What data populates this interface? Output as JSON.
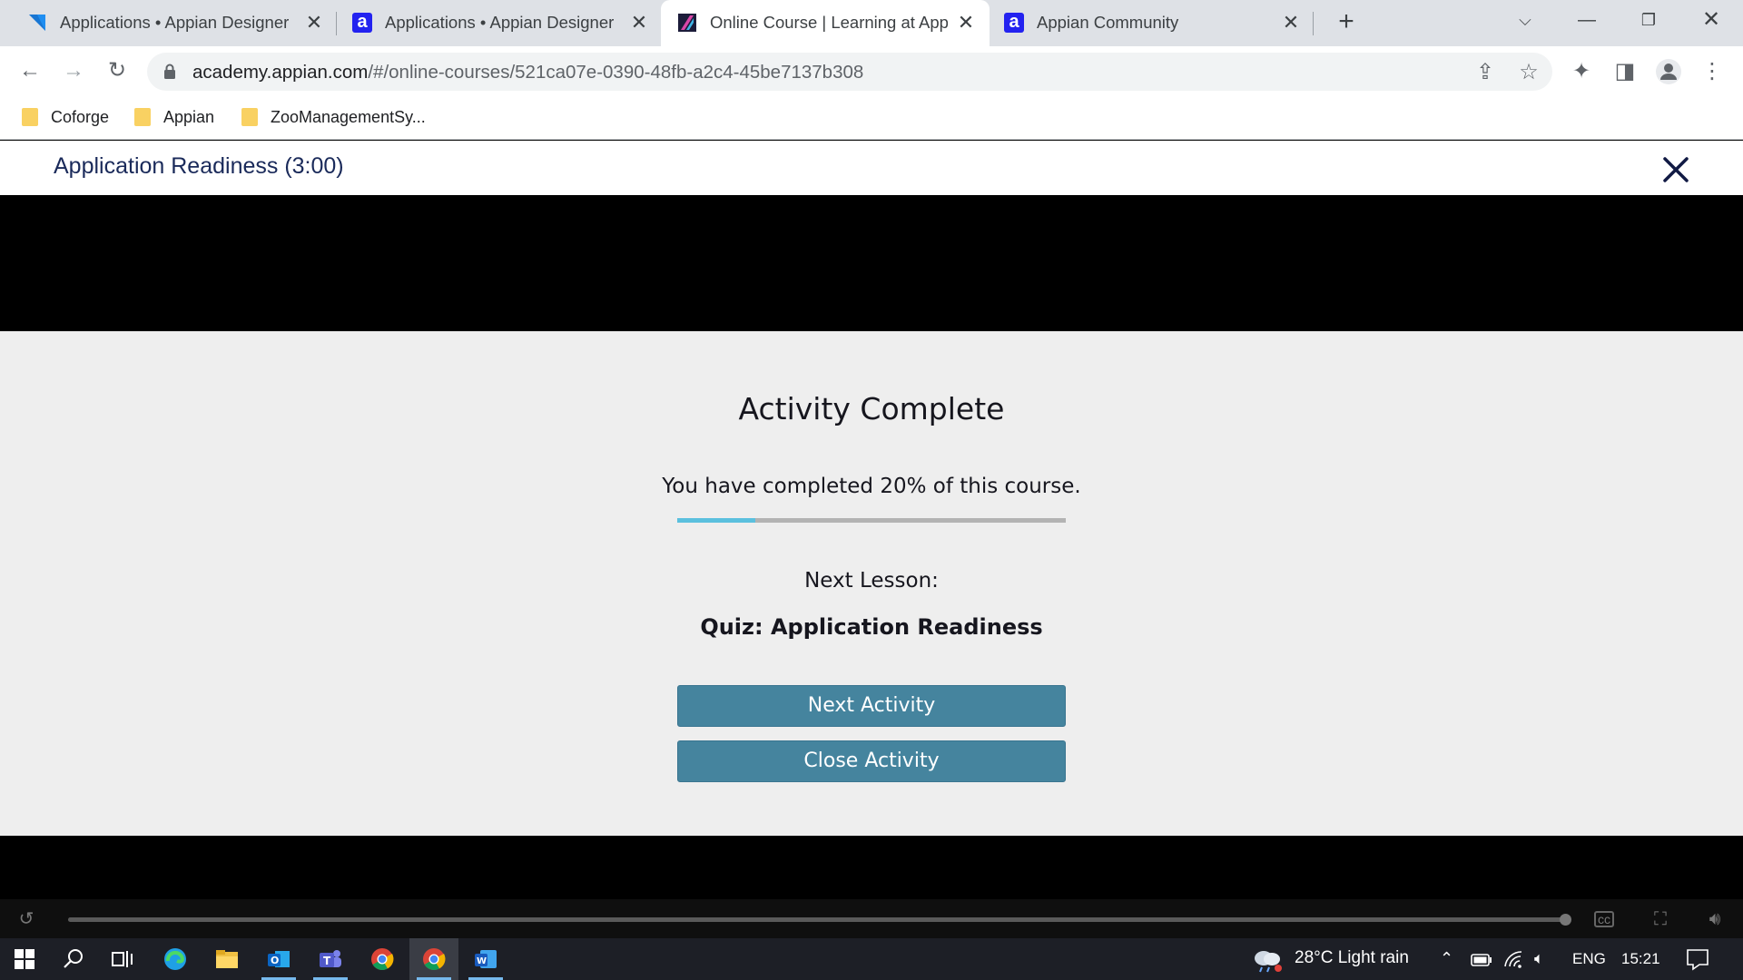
{
  "browser": {
    "tabs": [
      {
        "title": "Applications • Appian Designer",
        "favicon": "appian-designer-triangle-icon",
        "active": false
      },
      {
        "title": "Applications • Appian Designer",
        "favicon": "appian-a-icon",
        "active": false
      },
      {
        "title": "Online Course | Learning at Appian",
        "favicon": "appian-academy-icon",
        "active": true
      },
      {
        "title": "Appian Community",
        "favicon": "appian-a-icon",
        "active": false
      }
    ],
    "url_host": "academy.appian.com",
    "url_path": "/#/online-courses/521ca07e-0390-48fb-a2c4-45be7137b308",
    "bookmarks": [
      {
        "label": "Coforge"
      },
      {
        "label": "Appian"
      },
      {
        "label": "ZooManagementSy..."
      }
    ]
  },
  "course": {
    "title": "Application Readiness (3:00)"
  },
  "activity": {
    "heading": "Activity Complete",
    "progress_text": "You have completed 20% of this course.",
    "progress_fraction": 0.2,
    "next_label": "Next Lesson:",
    "next_title": "Quiz: Application Readiness",
    "next_button": "Next Activity",
    "close_button": "Close Activity"
  },
  "player": {
    "seek_fraction": 1.0
  },
  "taskbar": {
    "weather": "28°C  Light rain",
    "language": "ENG",
    "time": "15:21"
  },
  "colors": {
    "button": "#45849e",
    "progress_fill": "#5bc0de",
    "progress_track": "#b3b3b3",
    "content_bg": "#eeeeee"
  }
}
